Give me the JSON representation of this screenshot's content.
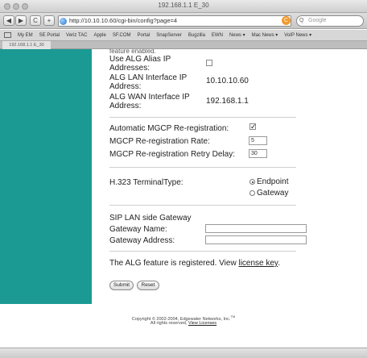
{
  "window": {
    "title": "192.168.1.1 E_30"
  },
  "toolbar": {
    "back_glyph": "◀",
    "forward_glyph": "▶",
    "reload_glyph": "C",
    "add_glyph": "+",
    "url": "http://10.10.10.60/cgi-bin/config?page=4",
    "search_placeholder": "Google",
    "refresh_glyph": "C"
  },
  "bookmarks": [
    "My EM",
    "SE Portal",
    "Veriz TAC",
    "Apple",
    "SF.COM",
    "Portal",
    "SnapServer",
    "Bugzilla",
    "EWN",
    "News ▾",
    "Mac News ▾",
    "VoIP News ▾"
  ],
  "tab": {
    "label": "192.168.1.1 E_30"
  },
  "form": {
    "truncated_heading": "feature enabled.",
    "alg_alias": {
      "label_1": "Use ALG Alias IP",
      "label_2": "Addresses:",
      "checked": false
    },
    "alg_lan": {
      "label_1": "ALG LAN Interface IP",
      "label_2": "Address:",
      "value": "10.10.10.60"
    },
    "alg_wan": {
      "label_1": "ALG WAN Interface IP",
      "label_2": "Address:",
      "value": "192.168.1.1"
    },
    "mgcp_auto": {
      "label": "Automatic MGCP Re-registration:",
      "checked": true
    },
    "mgcp_rate": {
      "label": "MGCP Re-registration Rate:",
      "value": "5"
    },
    "mgcp_retry": {
      "label": "MGCP Re-registration Retry Delay:",
      "value": "30"
    },
    "h323": {
      "label": "H.323 TerminalType:",
      "options": [
        "Endpoint",
        "Gateway"
      ],
      "selected": "Endpoint"
    },
    "sip": {
      "heading": "SIP LAN side Gateway",
      "name_label": "Gateway Name:",
      "name_value": "",
      "address_label": "Gateway Address:",
      "address_value": ""
    },
    "registered_text": "The ALG feature is registered. View",
    "license_link": "license key",
    "license_period": ".",
    "submit_label": "Submit",
    "reset_label": "Reset"
  },
  "footer": {
    "line1": "Copyright © 2002-2004, Edgewater Networks, Inc.",
    "trademark": "TM",
    "line2_prefix": "All rights reserved,",
    "line2_link": "View Licenses"
  }
}
